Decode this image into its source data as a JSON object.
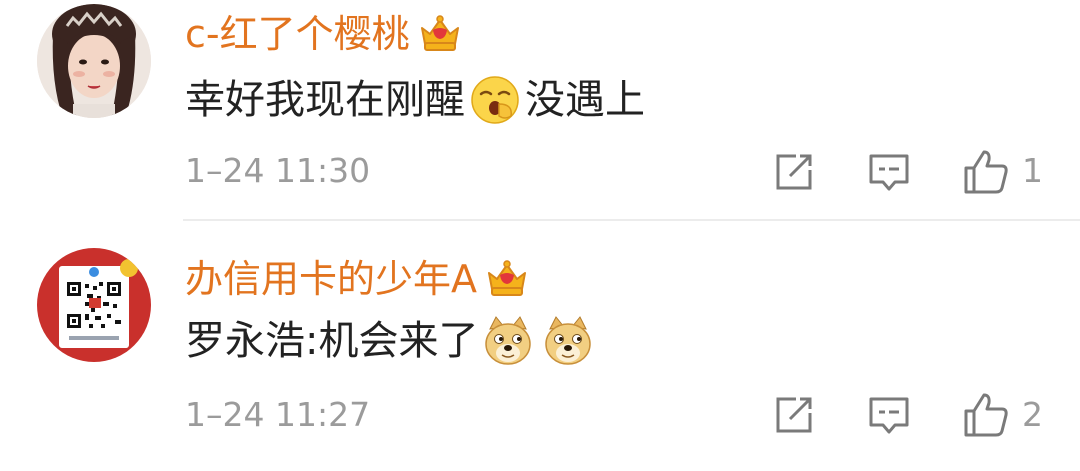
{
  "comments": [
    {
      "username": "c-红了个樱桃",
      "text_before": "幸好我现在刚醒",
      "text_after": "没遇上",
      "time": "1–24 11:30",
      "likes": "1",
      "avatar_icon": "girl-photo-avatar",
      "badge_icon": "crown-badge-icon",
      "emoji_icon": "yawn-emoji-icon"
    },
    {
      "username": "办信用卡的少年A",
      "text_before": "罗永浩:机会来了",
      "text_after": "",
      "time": "1–24 11:27",
      "likes": "2",
      "avatar_icon": "qr-code-avatar",
      "badge_icon": "crown-badge-icon",
      "emoji_icon": "doge-emoji-icon",
      "emoji_count": 2
    }
  ],
  "colors": {
    "username": "#e2741f",
    "text": "#222222",
    "meta": "#9b9b9b",
    "divider": "#ececec"
  }
}
